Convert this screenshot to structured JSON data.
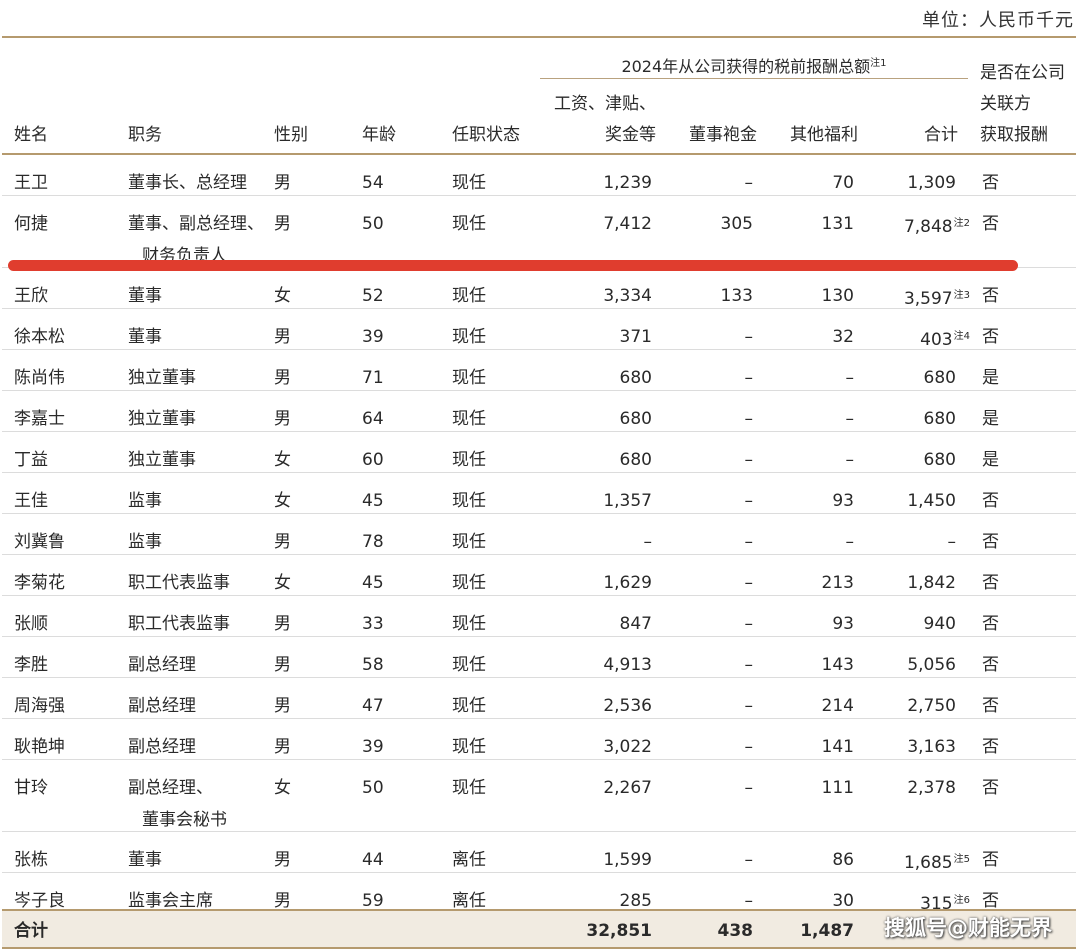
{
  "unit_label": "单位：人民币千元",
  "group_header": "2024年从公司获得的税前报酬总额",
  "group_note": "注1",
  "headers": {
    "name": "姓名",
    "position": "职务",
    "gender": "性别",
    "age": "年龄",
    "status": "任职状态",
    "salary_line1": "工资、津贴、",
    "salary_line2": "奖金等",
    "director_fee": "董事袍金",
    "other_benefits": "其他福利",
    "total": "合计",
    "related_line1": "是否在公司",
    "related_line2": "关联方",
    "related_line3": "获取报酬"
  },
  "rows": [
    {
      "name": "王卫",
      "position": [
        "董事长、总经理"
      ],
      "gender": "男",
      "age": "54",
      "status": "现任",
      "salary": "1,239",
      "fee": "–",
      "other": "70",
      "total": "1,309",
      "note": "",
      "related": "否"
    },
    {
      "name": "何捷",
      "position": [
        "董事、副总经理、",
        "财务负责人"
      ],
      "gender": "男",
      "age": "50",
      "status": "现任",
      "salary": "7,412",
      "fee": "305",
      "other": "131",
      "total": "7,848",
      "note": "注2",
      "related": "否"
    },
    {
      "name": "王欣",
      "position": [
        "董事"
      ],
      "gender": "女",
      "age": "52",
      "status": "现任",
      "salary": "3,334",
      "fee": "133",
      "other": "130",
      "total": "3,597",
      "note": "注3",
      "related": "否"
    },
    {
      "name": "徐本松",
      "position": [
        "董事"
      ],
      "gender": "男",
      "age": "39",
      "status": "现任",
      "salary": "371",
      "fee": "–",
      "other": "32",
      "total": "403",
      "note": "注4",
      "related": "否"
    },
    {
      "name": "陈尚伟",
      "position": [
        "独立董事"
      ],
      "gender": "男",
      "age": "71",
      "status": "现任",
      "salary": "680",
      "fee": "–",
      "other": "–",
      "total": "680",
      "note": "",
      "related": "是"
    },
    {
      "name": "李嘉士",
      "position": [
        "独立董事"
      ],
      "gender": "男",
      "age": "64",
      "status": "现任",
      "salary": "680",
      "fee": "–",
      "other": "–",
      "total": "680",
      "note": "",
      "related": "是"
    },
    {
      "name": "丁益",
      "position": [
        "独立董事"
      ],
      "gender": "女",
      "age": "60",
      "status": "现任",
      "salary": "680",
      "fee": "–",
      "other": "–",
      "total": "680",
      "note": "",
      "related": "是"
    },
    {
      "name": "王佳",
      "position": [
        "监事"
      ],
      "gender": "女",
      "age": "45",
      "status": "现任",
      "salary": "1,357",
      "fee": "–",
      "other": "93",
      "total": "1,450",
      "note": "",
      "related": "否"
    },
    {
      "name": "刘冀鲁",
      "position": [
        "监事"
      ],
      "gender": "男",
      "age": "78",
      "status": "现任",
      "salary": "–",
      "fee": "–",
      "other": "–",
      "total": "–",
      "note": "",
      "related": "否"
    },
    {
      "name": "李菊花",
      "position": [
        "职工代表监事"
      ],
      "gender": "女",
      "age": "45",
      "status": "现任",
      "salary": "1,629",
      "fee": "–",
      "other": "213",
      "total": "1,842",
      "note": "",
      "related": "否"
    },
    {
      "name": "张顺",
      "position": [
        "职工代表监事"
      ],
      "gender": "男",
      "age": "33",
      "status": "现任",
      "salary": "847",
      "fee": "–",
      "other": "93",
      "total": "940",
      "note": "",
      "related": "否"
    },
    {
      "name": "李胜",
      "position": [
        "副总经理"
      ],
      "gender": "男",
      "age": "58",
      "status": "现任",
      "salary": "4,913",
      "fee": "–",
      "other": "143",
      "total": "5,056",
      "note": "",
      "related": "否"
    },
    {
      "name": "周海强",
      "position": [
        "副总经理"
      ],
      "gender": "男",
      "age": "47",
      "status": "现任",
      "salary": "2,536",
      "fee": "–",
      "other": "214",
      "total": "2,750",
      "note": "",
      "related": "否"
    },
    {
      "name": "耿艳坤",
      "position": [
        "副总经理"
      ],
      "gender": "男",
      "age": "39",
      "status": "现任",
      "salary": "3,022",
      "fee": "–",
      "other": "141",
      "total": "3,163",
      "note": "",
      "related": "否"
    },
    {
      "name": "甘玲",
      "position": [
        "副总经理、",
        "董事会秘书"
      ],
      "gender": "女",
      "age": "50",
      "status": "现任",
      "salary": "2,267",
      "fee": "–",
      "other": "111",
      "total": "2,378",
      "note": "",
      "related": "否"
    },
    {
      "name": "张栋",
      "position": [
        "董事"
      ],
      "gender": "男",
      "age": "44",
      "status": "离任",
      "salary": "1,599",
      "fee": "–",
      "other": "86",
      "total": "1,685",
      "note": "注5",
      "related": "否"
    },
    {
      "name": "岑子良",
      "position": [
        "监事会主席"
      ],
      "gender": "男",
      "age": "59",
      "status": "离任",
      "salary": "285",
      "fee": "–",
      "other": "30",
      "total": "315",
      "note": "注6",
      "related": "否"
    }
  ],
  "totals": {
    "label": "合计",
    "salary": "32,851",
    "fee": "438",
    "other": "1,487"
  },
  "watermark": "搜狐号@财能无界"
}
